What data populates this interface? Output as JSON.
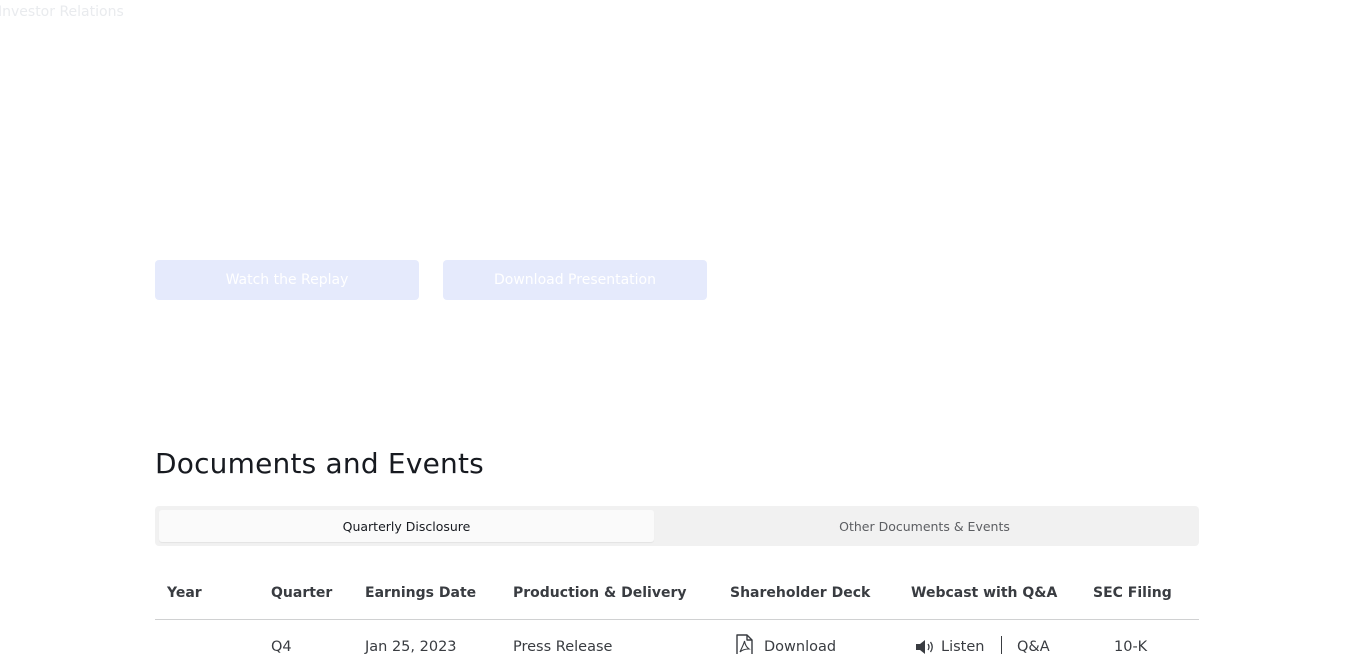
{
  "header": {
    "label": "Investor Relations"
  },
  "hero": {
    "replay_button": "Watch the Replay",
    "presentation_button": "Download Presentation"
  },
  "documents": {
    "title": "Documents and Events",
    "tabs": [
      {
        "label": "Quarterly Disclosure",
        "active": true
      },
      {
        "label": "Other Documents & Events",
        "active": false
      }
    ],
    "columns": [
      "Year",
      "Quarter",
      "Earnings Date",
      "Production & Delivery",
      "Shareholder Deck",
      "Webcast with Q&A",
      "SEC Filing"
    ],
    "rows": [
      {
        "year": "",
        "quarter": "Q4",
        "earnings_date": "Jan 25, 2023",
        "production_delivery": "Press Release",
        "shareholder_deck": "Download",
        "webcast_listen": "Listen",
        "webcast_qa": "Q&A",
        "sec_filing": "10-K"
      }
    ]
  },
  "icons": {
    "pdf": "pdf-icon",
    "speaker": "speaker-icon"
  }
}
